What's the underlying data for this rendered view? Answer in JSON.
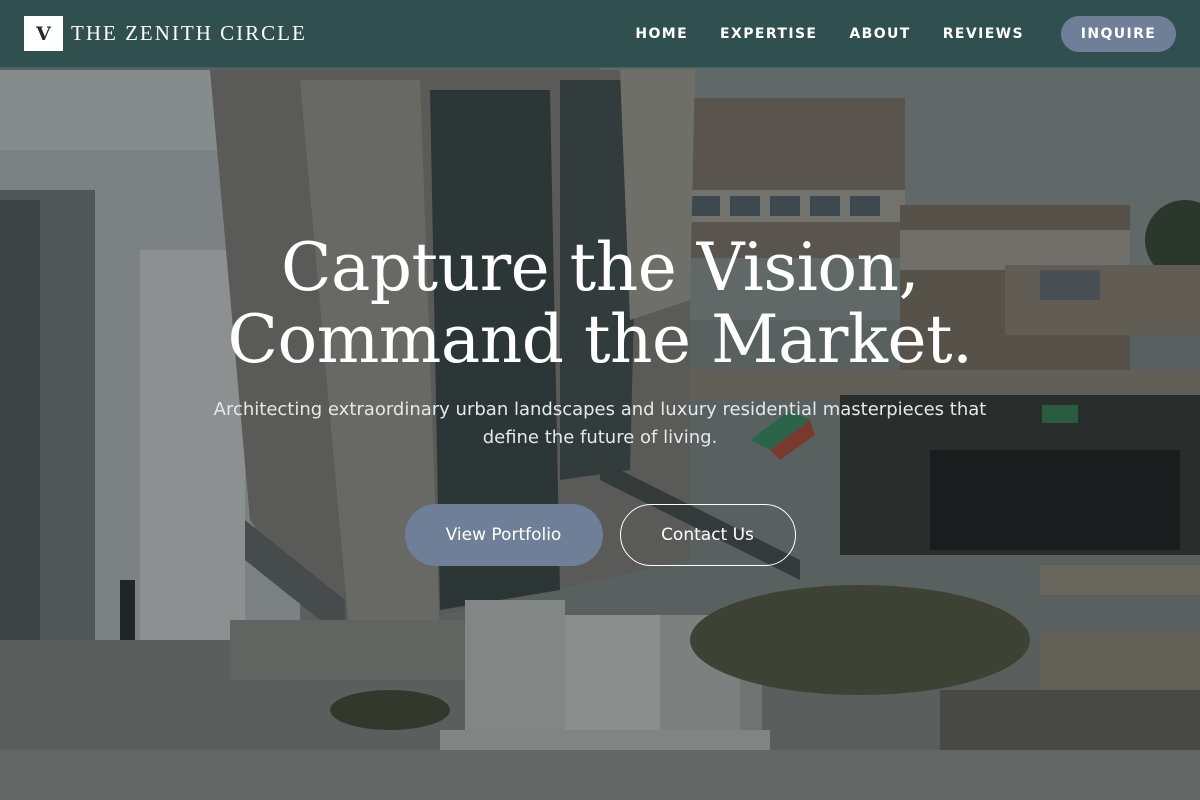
{
  "brand": {
    "mark": "V",
    "name": "THE ZENITH CIRCLE"
  },
  "nav": {
    "links": [
      "HOME",
      "EXPERTISE",
      "ABOUT",
      "REVIEWS"
    ],
    "cta_label": "INQUIRE"
  },
  "hero": {
    "title_line1": "Capture the Vision,",
    "title_line2": "Command the Market.",
    "subtitle": "Architecting extraordinary urban landscapes and luxury residential masterpieces that define the future of living.",
    "primary_button": "View Portfolio",
    "secondary_button": "Contact Us",
    "background_image": "brutalist-concrete-buildings-photo"
  },
  "colors": {
    "navbar": "#2c4e4e",
    "accent_button": "#6f7f97",
    "text": "#ffffff"
  }
}
